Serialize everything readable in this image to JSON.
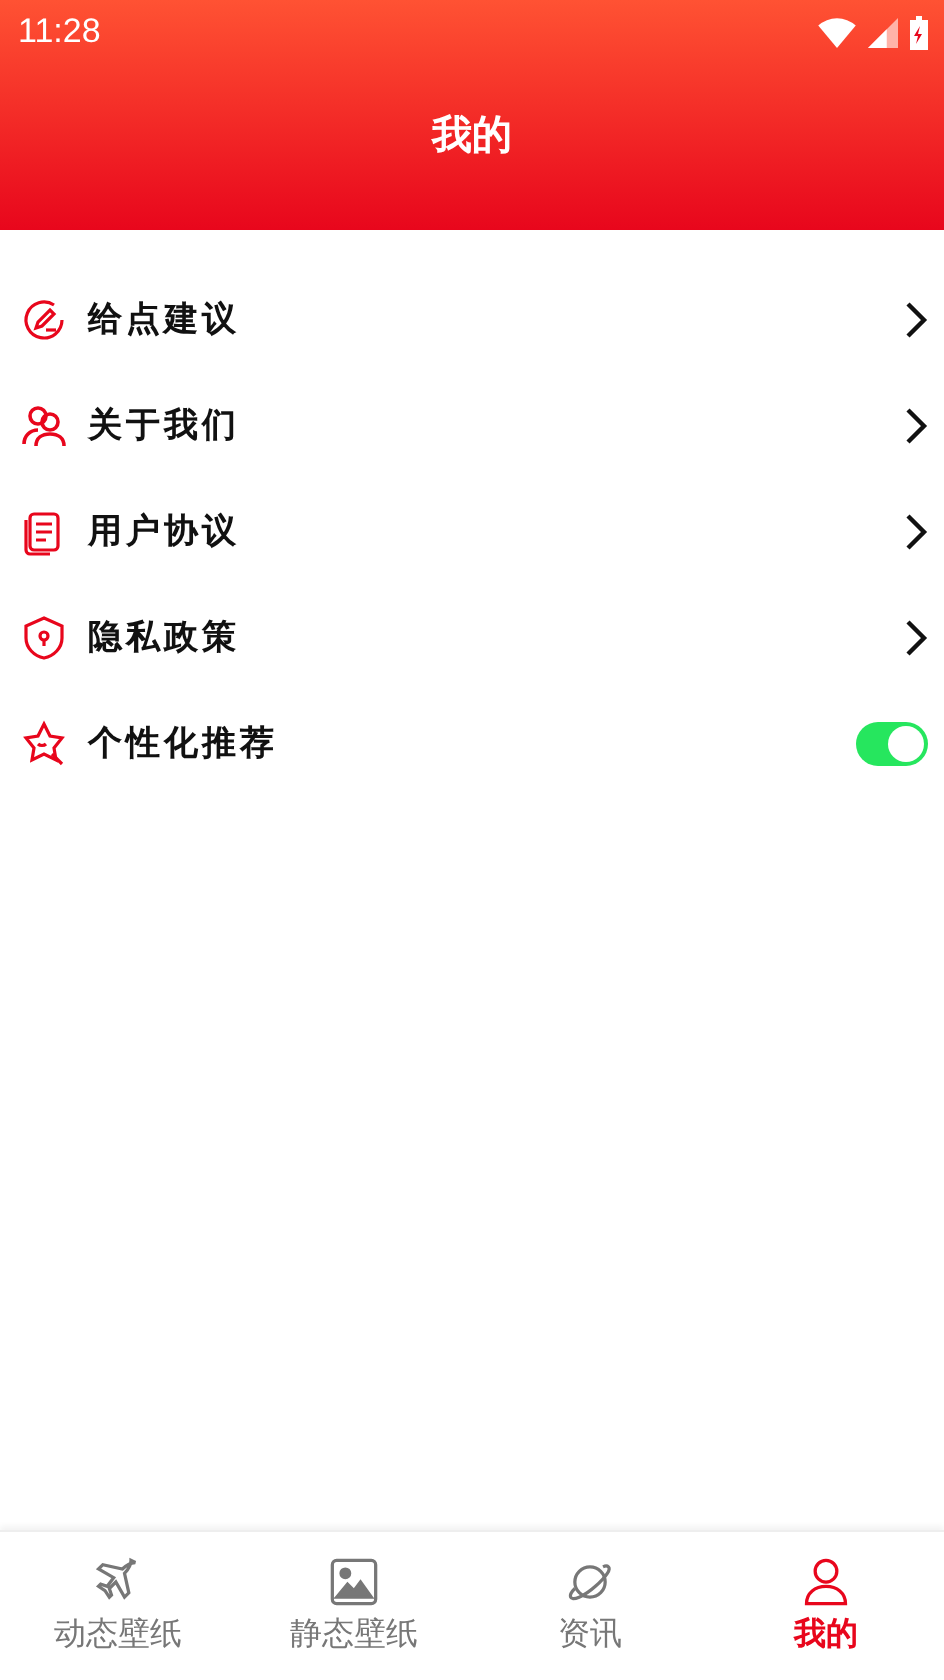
{
  "status_bar": {
    "time": "11:28"
  },
  "header": {
    "title": "我的"
  },
  "menu": [
    {
      "label": "给点建议",
      "kind": "link"
    },
    {
      "label": "关于我们",
      "kind": "link"
    },
    {
      "label": "用户协议",
      "kind": "link"
    },
    {
      "label": "隐私政策",
      "kind": "link"
    },
    {
      "label": "个性化推荐",
      "kind": "toggle",
      "on": true
    }
  ],
  "tab_bar": [
    {
      "label": "动态壁纸",
      "selected": false
    },
    {
      "label": "静态壁纸",
      "selected": false
    },
    {
      "label": "资讯",
      "selected": false
    },
    {
      "label": "我的",
      "selected": true
    }
  ]
}
